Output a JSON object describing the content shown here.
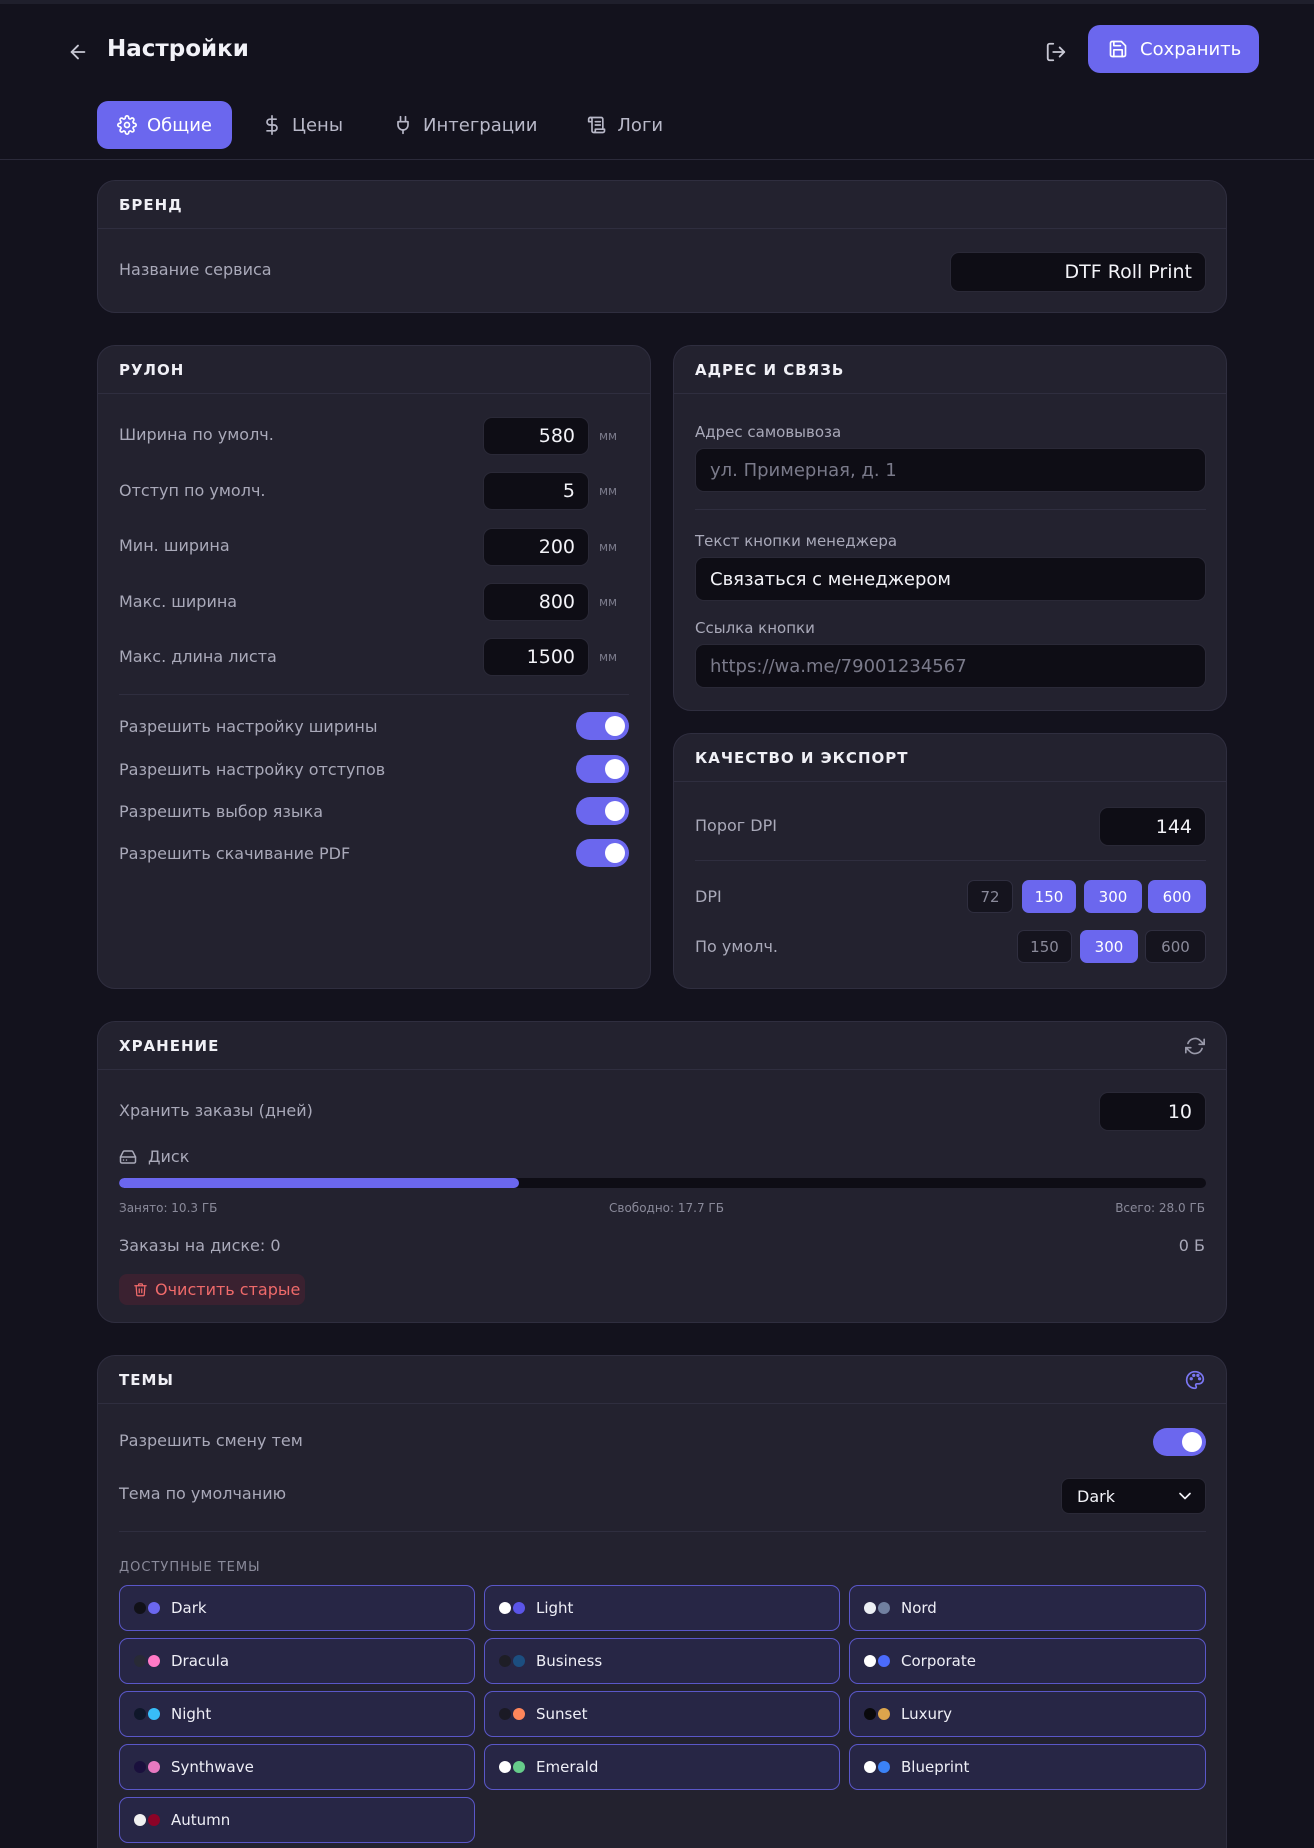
{
  "header": {
    "title": "Настройки",
    "save_label": "Сохранить"
  },
  "tabs": [
    {
      "label": "Общие",
      "icon": "gear-icon",
      "active": true
    },
    {
      "label": "Цены",
      "icon": "dollar-icon",
      "active": false
    },
    {
      "label": "Интеграции",
      "icon": "plug-icon",
      "active": false
    },
    {
      "label": "Логи",
      "icon": "scroll-icon",
      "active": false
    }
  ],
  "brand": {
    "title": "БРЕНД",
    "service_name_label": "Название сервиса",
    "service_name_value": "DTF Roll Print"
  },
  "roll": {
    "title": "РУЛОН",
    "fields": [
      {
        "label": "Ширина по умолч.",
        "value": "580",
        "unit": "мм"
      },
      {
        "label": "Отступ по умолч.",
        "value": "5",
        "unit": "мм"
      },
      {
        "label": "Мин. ширина",
        "value": "200",
        "unit": "мм"
      },
      {
        "label": "Макс. ширина",
        "value": "800",
        "unit": "мм"
      },
      {
        "label": "Макс. длина листа",
        "value": "1500",
        "unit": "мм"
      }
    ],
    "toggles": [
      {
        "label": "Разрешить настройку ширины",
        "on": true
      },
      {
        "label": "Разрешить настройку отступов",
        "on": true
      },
      {
        "label": "Разрешить выбор языка",
        "on": true
      },
      {
        "label": "Разрешить скачивание PDF",
        "on": true
      }
    ]
  },
  "address": {
    "title": "АДРЕС И СВЯЗЬ",
    "pickup_label": "Адрес самовывоза",
    "pickup_placeholder": "ул. Примерная, д. 1",
    "manager_btn_label": "Текст кнопки менеджера",
    "manager_btn_value": "Связаться с менеджером",
    "btn_link_label": "Ссылка кнопки",
    "btn_link_placeholder": "https://wa.me/79001234567"
  },
  "quality": {
    "title": "КАЧЕСТВО И ЭКСПОРТ",
    "dpi_threshold_label": "Порог DPI",
    "dpi_threshold_value": "144",
    "dpi_label": "DPI",
    "dpi_options": [
      {
        "label": "72",
        "on": false
      },
      {
        "label": "150",
        "on": true
      },
      {
        "label": "300",
        "on": true
      },
      {
        "label": "600",
        "on": true
      }
    ],
    "default_label": "По умолч.",
    "default_options": [
      {
        "label": "150",
        "on": false
      },
      {
        "label": "300",
        "on": true
      },
      {
        "label": "600",
        "on": false
      }
    ]
  },
  "storage": {
    "title": "ХРАНЕНИЕ",
    "keep_label": "Хранить заказы (дней)",
    "keep_value": "10",
    "disk_label": "Диск",
    "used_fraction": 0.368,
    "used_text": "Занято: 10.3 ГБ",
    "free_text": "Свободно: 17.7 ГБ",
    "total_text": "Всего: 28.0 ГБ",
    "orders_on_disk": "Заказы на диске: 0",
    "orders_size": "0 Б",
    "clean_label": "Очистить старые"
  },
  "themes": {
    "title": "ТЕМЫ",
    "allow_label": "Разрешить смену тем",
    "allow_on": true,
    "default_label": "Тема по умолчанию",
    "default_value": "Dark",
    "available_label": "ДОСТУПНЫЕ ТЕМЫ",
    "list": [
      {
        "name": "Dark",
        "c1": "#111118",
        "c2": "#6b67ee"
      },
      {
        "name": "Light",
        "c1": "#ffffff",
        "c2": "#5b55e8"
      },
      {
        "name": "Nord",
        "c1": "#eceff4",
        "c2": "#7180a0"
      },
      {
        "name": "Dracula",
        "c1": "#282a36",
        "c2": "#ff79c6"
      },
      {
        "name": "Business",
        "c1": "#1e1e26",
        "c2": "#1c4e80"
      },
      {
        "name": "Corporate",
        "c1": "#ffffff",
        "c2": "#4b6bfb"
      },
      {
        "name": "Night",
        "c1": "#0f172a",
        "c2": "#38bdf8"
      },
      {
        "name": "Sunset",
        "c1": "#1b1a25",
        "c2": "#ff865b"
      },
      {
        "name": "Luxury",
        "c1": "#09090b",
        "c2": "#dca54c"
      },
      {
        "name": "Synthwave",
        "c1": "#1a103d",
        "c2": "#e779c1"
      },
      {
        "name": "Emerald",
        "c1": "#ffffff",
        "c2": "#66cc8a"
      },
      {
        "name": "Blueprint",
        "c1": "#ffffff",
        "c2": "#3b82f6"
      },
      {
        "name": "Autumn",
        "c1": "#f1f1f1",
        "c2": "#8c0327"
      }
    ]
  }
}
